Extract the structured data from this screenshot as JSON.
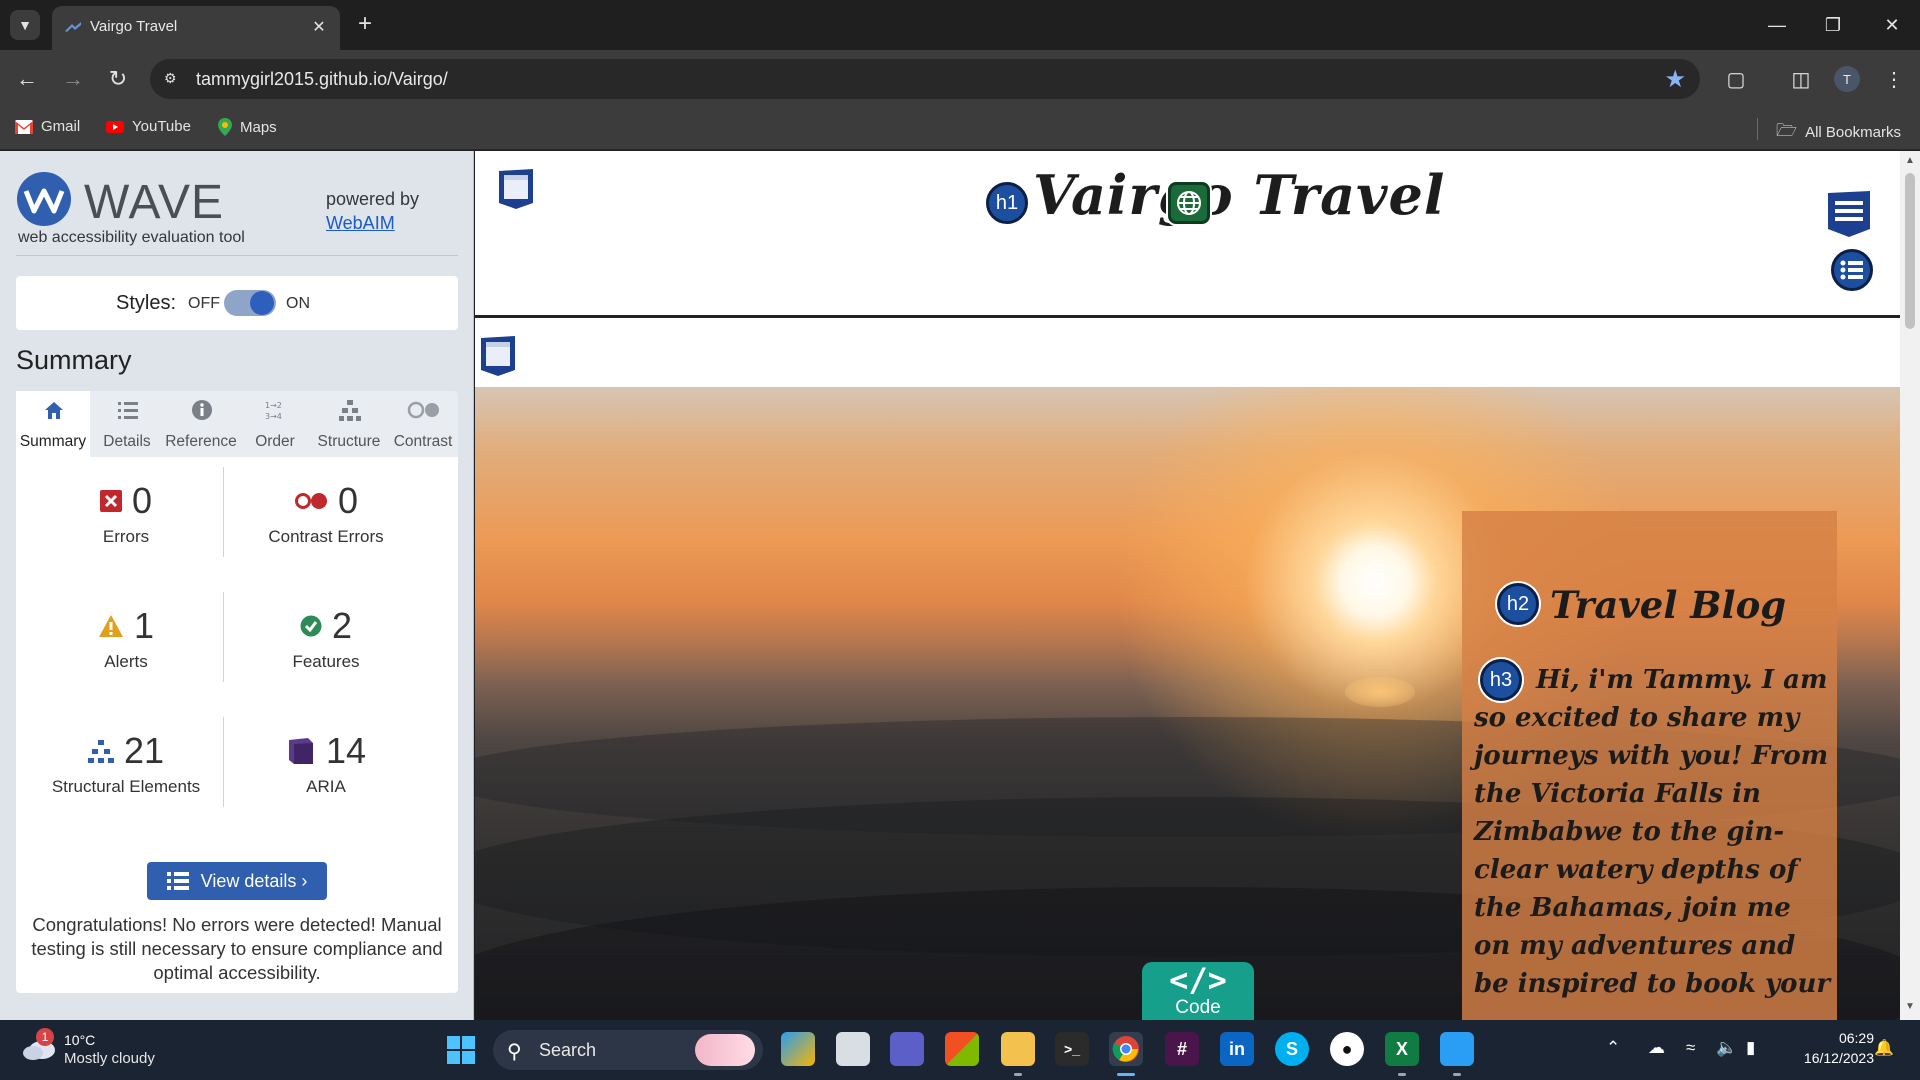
{
  "browser": {
    "tab_title": "Vairgo Travel",
    "url": "tammygirl2015.github.io/Vairgo/",
    "profile_initial": "T",
    "bookmarks": [
      {
        "label": "Gmail",
        "icon": "gmail-icon"
      },
      {
        "label": "YouTube",
        "icon": "youtube-icon"
      },
      {
        "label": "Maps",
        "icon": "maps-icon"
      }
    ],
    "all_bookmarks": "All Bookmarks"
  },
  "wave": {
    "logo_text": "WAVE",
    "subtitle": "web accessibility evaluation tool",
    "powered_by": "powered by",
    "webaim_link": "WebAIM",
    "styles_label": "Styles:",
    "styles_off": "OFF",
    "styles_on": "ON",
    "styles_enabled": true,
    "summary_heading": "Summary",
    "tabs": [
      {
        "label": "Summary",
        "icon": "home-icon",
        "active": true
      },
      {
        "label": "Details",
        "icon": "list-icon",
        "active": false
      },
      {
        "label": "Reference",
        "icon": "info-icon",
        "active": false
      },
      {
        "label": "Order",
        "icon": "order-icon",
        "active": false
      },
      {
        "label": "Structure",
        "icon": "structure-icon",
        "active": false
      },
      {
        "label": "Contrast",
        "icon": "contrast-icon",
        "active": false
      }
    ],
    "stats": {
      "errors": {
        "count": "0",
        "label": "Errors"
      },
      "contrast_errors": {
        "count": "0",
        "label": "Contrast Errors"
      },
      "alerts": {
        "count": "1",
        "label": "Alerts"
      },
      "features": {
        "count": "2",
        "label": "Features"
      },
      "structural": {
        "count": "21",
        "label": "Structural Elements"
      },
      "aria": {
        "count": "14",
        "label": "ARIA"
      }
    },
    "view_details": "View details ›",
    "congrats": "Congratulations! No errors were detected! Manual testing is still necessary to ensure compliance and optimal accessibility."
  },
  "site": {
    "title": "Vairgo Travel",
    "blog_title": "Travel Blog",
    "blog_text": "Hi, i'm Tammy. I am so excited to share my journeys with you! From the Victoria Falls in Zimbabwe to the gin-clear watery depths of the Bahamas, join me on my adventures and be inspired to book your",
    "badges": {
      "h1": "h1",
      "h2": "h2",
      "h3": "h3"
    },
    "code_label": "Code",
    "code_glyph": "</>"
  },
  "taskbar": {
    "weather_temp": "10°C",
    "weather_cond": "Mostly cloudy",
    "weather_badge": "1",
    "search_label": "Search",
    "time": "06:29",
    "date": "16/12/2023"
  },
  "colors": {
    "wave_blue": "#2f5fae",
    "error_red": "#c0282d",
    "alert_orange": "#e0a01b",
    "feature_green": "#2e8b57",
    "aria_purple": "#5b3a8a",
    "code_teal": "#16a08c"
  }
}
